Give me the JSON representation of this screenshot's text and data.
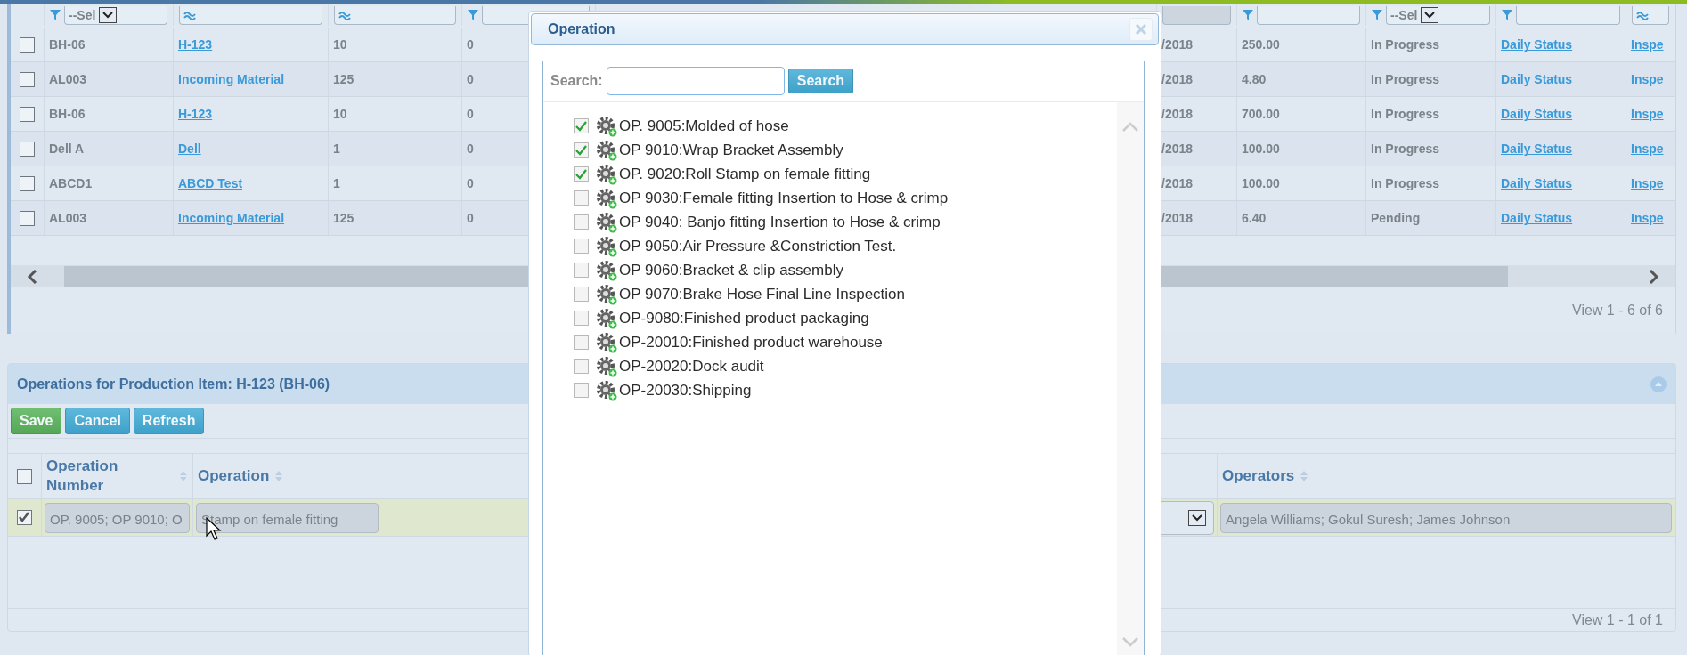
{
  "grid": {
    "columns": [
      {
        "kind": "text",
        "filter": {
          "kind": "select",
          "text": "--Sel"
        }
      },
      {
        "kind": "link",
        "filter": {
          "kind": "contains"
        }
      },
      {
        "kind": "text",
        "filter": {
          "kind": "contains"
        }
      },
      {
        "kind": "text",
        "filter": {
          "kind": "equals"
        }
      },
      {
        "kind": "text",
        "filter": {
          "kind": "plain"
        }
      },
      {
        "kind": "text",
        "filter": {
          "kind": "equals"
        }
      },
      {
        "kind": "text",
        "filter": {
          "kind": "select",
          "text": "--Sel"
        }
      },
      {
        "kind": "link",
        "filter": {
          "kind": "equals"
        }
      },
      {
        "kind": "link",
        "filter": {
          "kind": "contains"
        }
      }
    ],
    "rows": [
      {
        "checked": false,
        "cells": [
          "BH-06",
          "H-123",
          "10",
          "0",
          "/2018",
          "250.00",
          "In Progress",
          "Daily Status",
          "Inspe"
        ]
      },
      {
        "checked": false,
        "cells": [
          "AL003",
          "Incoming Material",
          "125",
          "0",
          "/2018",
          "4.80",
          "In Progress",
          "Daily Status",
          "Inspe"
        ]
      },
      {
        "checked": false,
        "cells": [
          "BH-06",
          "H-123",
          "10",
          "0",
          "/2018",
          "700.00",
          "In Progress",
          "Daily Status",
          "Inspe"
        ]
      },
      {
        "checked": false,
        "cells": [
          "Dell A",
          "Dell",
          "1",
          "0",
          "/2018",
          "100.00",
          "In Progress",
          "Daily Status",
          "Inspe"
        ]
      },
      {
        "checked": false,
        "cells": [
          "ABCD1",
          "ABCD Test",
          "1",
          "0",
          "/2018",
          "100.00",
          "In Progress",
          "Daily Status",
          "Inspe"
        ]
      },
      {
        "checked": false,
        "cells": [
          "AL003",
          "Incoming Material",
          "125",
          "0",
          "/2018",
          "6.40",
          "Pending",
          "Daily Status",
          "Inspe"
        ]
      }
    ],
    "pager": "View 1 - 6 of 6"
  },
  "operations_panel": {
    "title": "Operations for Production Item: H-123 (BH-06)",
    "buttons": [
      {
        "label": "Save",
        "kind": "primary"
      },
      {
        "label": "Cancel",
        "kind": "secondary"
      },
      {
        "label": "Refresh",
        "kind": "secondary"
      }
    ],
    "header_checked": false,
    "columns": [
      "Operation Number",
      "Operation",
      "Operators"
    ],
    "rows": [
      {
        "checked": true,
        "operation_number": "OP. 9005; OP 9010; O",
        "operation": "Stamp on female fitting",
        "operators": "Angela  Williams; Gokul Suresh; James  Johnson"
      }
    ],
    "pager": "View 1 - 1 of 1"
  },
  "dialog": {
    "title": "Operation",
    "search_label": "Search:",
    "search_button": "Search",
    "items": [
      {
        "label": "OP. 9005:Molded of hose",
        "checked": true
      },
      {
        "label": "OP 9010:Wrap Bracket Assembly",
        "checked": true
      },
      {
        "label": "OP. 9020:Roll Stamp on female fitting",
        "checked": true
      },
      {
        "label": "OP 9030:Female fitting Insertion to Hose & crimp",
        "checked": false
      },
      {
        "label": "OP 9040: Banjo fitting Insertion to Hose & crimp",
        "checked": false
      },
      {
        "label": "OP 9050:Air Pressure &Constriction Test.",
        "checked": false
      },
      {
        "label": "OP 9060:Bracket & clip assembly",
        "checked": false
      },
      {
        "label": "OP 9070:Brake Hose Final Line Inspection",
        "checked": false
      },
      {
        "label": "OP-9080:Finished product packaging",
        "checked": false
      },
      {
        "label": "OP-20010:Finished product warehouse",
        "checked": false
      },
      {
        "label": "OP-20020:Dock audit",
        "checked": false
      },
      {
        "label": "OP-20030:Shipping",
        "checked": false
      }
    ]
  }
}
